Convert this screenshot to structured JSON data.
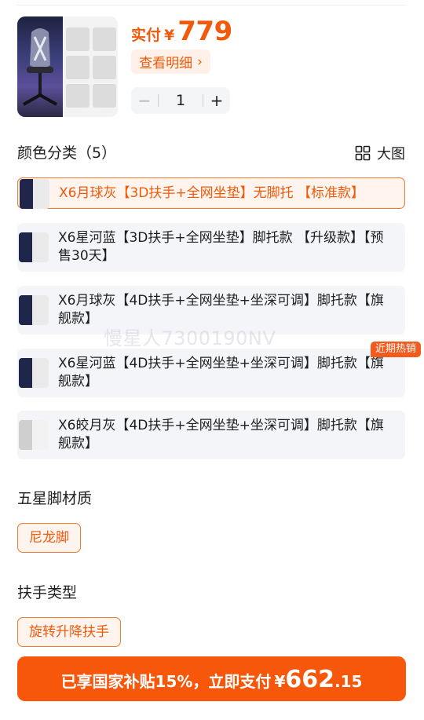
{
  "product": {
    "price_prefix": "实付",
    "currency": "¥",
    "price": "779",
    "detail_label": "查看明细",
    "detail_chevron": "›",
    "quantity": "1",
    "minus": "−",
    "plus": "+"
  },
  "color_section": {
    "title": "颜色分类（5）",
    "big_view_label": "大图",
    "big_view_icon": "grid-icon",
    "selected_index": 0,
    "options": [
      {
        "label": "X6月球灰【3D扶手+全网坐垫】无脚托 【标准款】"
      },
      {
        "label": "X6星河蓝【3D扶手+全网坐垫】脚托款 【升级款】【预售30天】"
      },
      {
        "label": "X6月球灰【4D扶手+全网坐垫+坐深可调】脚托款【旗舰款】"
      },
      {
        "label": "X6星河蓝【4D扶手+全网坐垫+坐深可调】脚托款【旗舰款】",
        "badge": "近期热销"
      },
      {
        "label": "X6皎月灰【4D扶手+全网坐垫+坐深可调】脚托款【旗舰款】"
      }
    ]
  },
  "watermark": "慢星人7300190NV",
  "base_section": {
    "title": "五星脚材质",
    "option": "尼龙脚"
  },
  "armrest_section": {
    "title": "扶手类型",
    "option": "旋转升降扶手"
  },
  "pay": {
    "text": "已享国家补贴15%，立即支付",
    "currency": "¥",
    "amount_int": "662",
    "amount_dec": ".15"
  },
  "colors": {
    "accent": "#f15a0b",
    "pay_button": "#f7570b",
    "selected_bg": "#fff4ee",
    "option_bg": "#f4f5f8"
  }
}
